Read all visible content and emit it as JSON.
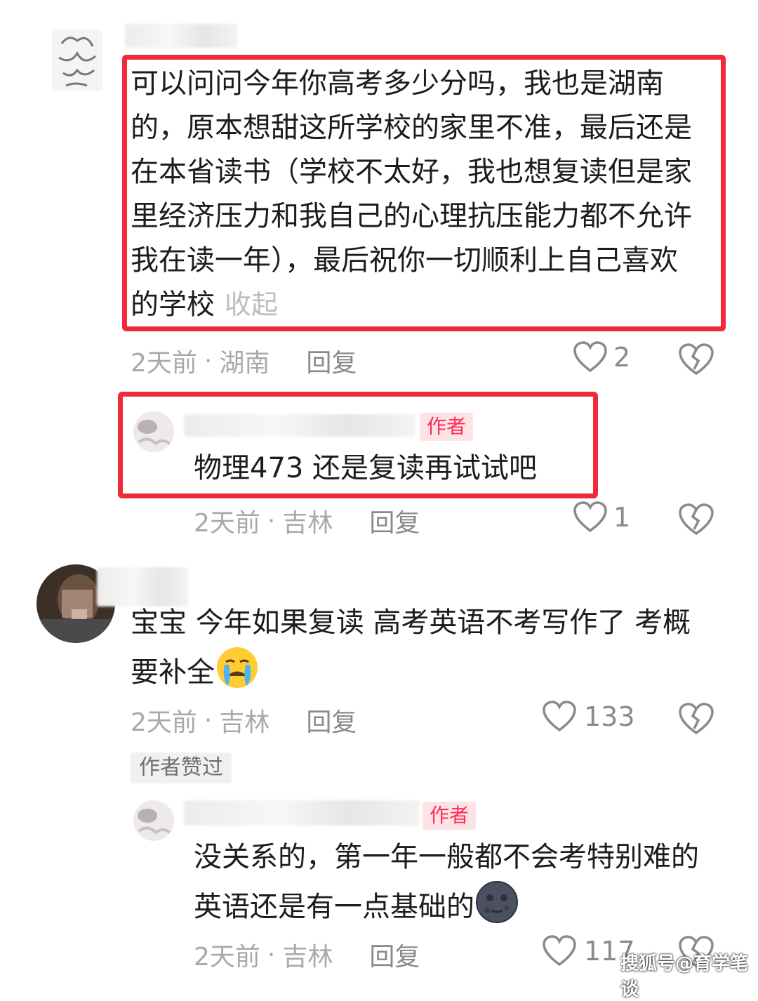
{
  "comments": [
    {
      "text": "可以问问今年你高考多少分吗，我也是湖南的，原本想甜这所学校的家里不准，最后还是在本省读书（学校不太好，我也想复读但是家里经济压力和我自己的心理抗压能力都不允许我在读一年），最后祝你一切顺利上自己喜欢的学校",
      "collapse": "收起",
      "time": "2天前",
      "location": "湖南",
      "reply": "回复",
      "likes": "2",
      "reply_item": {
        "tag": "作者",
        "text": "物理473 还是复读再试试吧",
        "time": "2天前",
        "location": "吉林",
        "reply": "回复",
        "likes": "1"
      }
    },
    {
      "text": "宝宝 今年如果复读 高考英语不考写作了 考概要补全",
      "time": "2天前",
      "location": "吉林",
      "reply": "回复",
      "likes": "133",
      "liked_badge": "作者赞过",
      "reply_item": {
        "tag": "作者",
        "text": "没关系的，第一年一般都不会考特别难的 英语还是有一点基础的",
        "time": "2天前",
        "location": "吉林",
        "reply": "回复",
        "likes": "117"
      }
    }
  ],
  "watermark": "搜狐号@育学笔谈",
  "colors": {
    "highlight": "#ef2b3a",
    "author_tag": "#fe2c55"
  }
}
